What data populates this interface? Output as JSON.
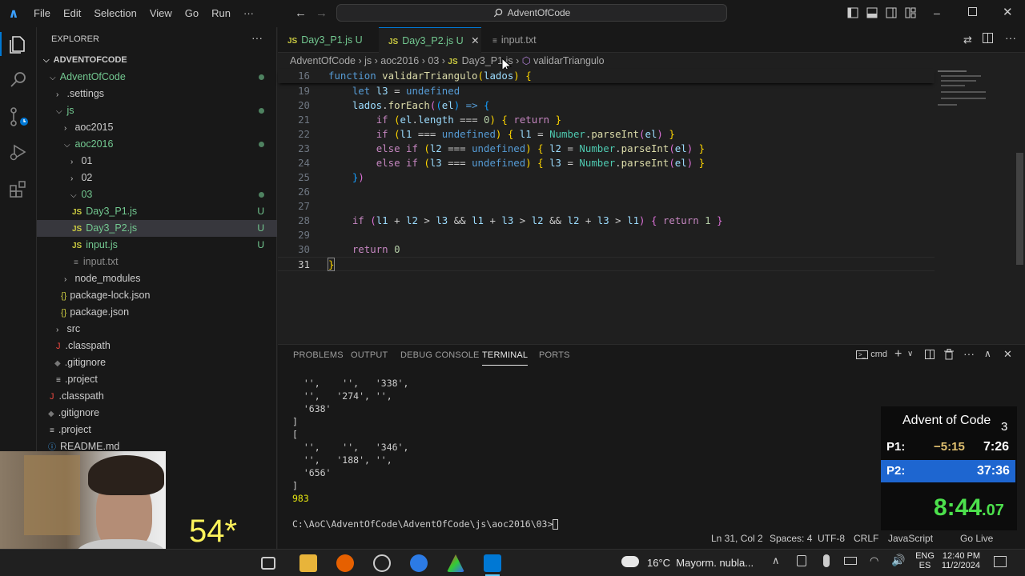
{
  "titlebar": {
    "menus": [
      "File",
      "Edit",
      "Selection",
      "View",
      "Go",
      "Run",
      "···"
    ],
    "search_text": "AdventOfCode"
  },
  "explorer": {
    "header": "EXPLORER",
    "root": "ADVENTOFCODE",
    "items": [
      {
        "label": "AdventOfCode"
      },
      {
        "label": ".settings"
      },
      {
        "label": "js"
      },
      {
        "label": "aoc2015"
      },
      {
        "label": "aoc2016"
      },
      {
        "label": "01"
      },
      {
        "label": "02"
      },
      {
        "label": "03"
      },
      {
        "label": "Day3_P1.js",
        "badge": "U"
      },
      {
        "label": "Day3_P2.js",
        "badge": "U"
      },
      {
        "label": "input.js",
        "badge": "U"
      },
      {
        "label": "input.txt"
      },
      {
        "label": "node_modules"
      },
      {
        "label": "package-lock.json"
      },
      {
        "label": "package.json"
      },
      {
        "label": "src"
      },
      {
        "label": ".classpath"
      },
      {
        "label": ".gitignore"
      },
      {
        "label": ".project"
      },
      {
        "label": ".classpath"
      },
      {
        "label": ".gitignore"
      },
      {
        "label": ".project"
      },
      {
        "label": "README.md"
      }
    ]
  },
  "tabs": [
    {
      "label": "Day3_P1.js",
      "badge": "U"
    },
    {
      "label": "Day3_P2.js",
      "badge": "U"
    },
    {
      "label": "input.txt"
    }
  ],
  "breadcrumbs": [
    "AdventOfCode",
    "js",
    "aoc2016",
    "03",
    "Day3_P1.js",
    "validarTriangulo"
  ],
  "code_lines": [
    "16",
    "19",
    "20",
    "21",
    "22",
    "23",
    "24",
    "25",
    "26",
    "27",
    "28",
    "29",
    "30",
    "31"
  ],
  "panel": {
    "tabs": [
      "PROBLEMS",
      "OUTPUT",
      "DEBUG CONSOLE",
      "TERMINAL",
      "PORTS"
    ],
    "shell": "cmd",
    "terminal": [
      "  '',    '',   '338',",
      "  '',   '274', '',",
      "  '638'",
      "]",
      "[",
      "  '',    '',   '346',",
      "  '',   '188', '',",
      "  '656'",
      "]",
      "983",
      "",
      "C:\\AoC\\AdventOfCode\\AdventOfCode\\js\\aoc2016\\03>"
    ]
  },
  "statusbar": {
    "position": "Ln 31, Col 2",
    "spaces": "Spaces: 4",
    "encoding": "UTF-8",
    "eol": "CRLF",
    "language": "JavaScript",
    "golive": "Go Live"
  },
  "timer": {
    "title": "Advent of Code",
    "day": "3",
    "p1_label": "P1:",
    "p1_delta": "−5:15",
    "p1_time": "7:26",
    "p2_label": "P2:",
    "p2_time": "37:36",
    "main": "8:44",
    "main_fraction": ".07"
  },
  "counter": "54*",
  "taskbar": {
    "weather": "16°C  Mayorm. nubla...",
    "lang": "ENG",
    "region": "ES",
    "time": "12:40 PM",
    "date": "11/2/2024"
  },
  "colors": {
    "accent": "#0078d4",
    "git_untracked": "#73c991",
    "timer_highlight": "#1e66d0",
    "timer_gold": "#e0c070",
    "counter": "#fdf35b"
  }
}
